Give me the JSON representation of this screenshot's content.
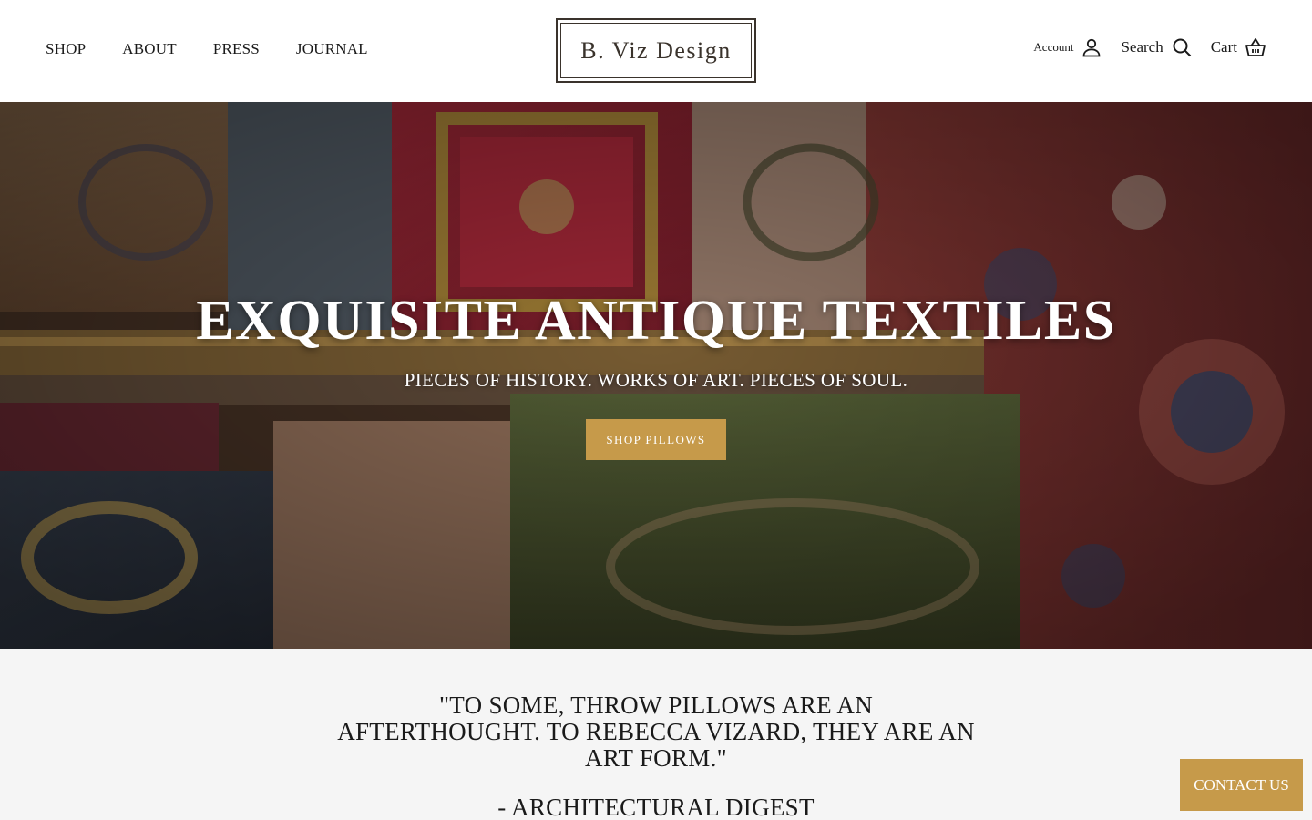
{
  "nav": {
    "items": [
      {
        "label": "SHOP"
      },
      {
        "label": "ABOUT"
      },
      {
        "label": "PRESS"
      },
      {
        "label": "JOURNAL"
      }
    ]
  },
  "logo": {
    "text": "B. Viz Design"
  },
  "utils": {
    "account": "Account",
    "search": "Search",
    "cart": "Cart"
  },
  "hero": {
    "title": "EXQUISITE ANTIQUE TEXTILES",
    "subtitle": "PIECES OF HISTORY. WORKS OF ART. PIECES OF SOUL.",
    "button": "SHOP PILLOWS"
  },
  "quote": {
    "text": "\"TO SOME, THROW PILLOWS ARE AN AFTERTHOUGHT. TO REBECCA VIZARD, THEY ARE AN ART FORM.\"",
    "attribution": "- ARCHITECTURAL DIGEST"
  },
  "contact": {
    "label": "CONTACT US"
  },
  "colors": {
    "accent": "#c69a4a",
    "text": "#1a1a1a",
    "background": "#f5f5f5"
  }
}
